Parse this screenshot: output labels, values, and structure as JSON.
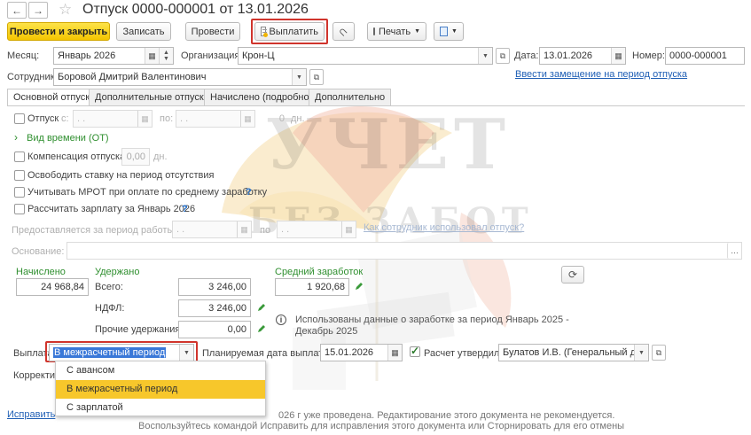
{
  "window": {
    "title": "Отпуск 0000-000001 от 13.01.2026"
  },
  "toolbar": {
    "post_and_close": "Провести и закрыть",
    "record": "Записать",
    "post": "Провести",
    "pay": "Выплатить",
    "print": "Печать"
  },
  "header": {
    "month_label": "Месяц:",
    "month_value": "Январь 2026",
    "org_label": "Организация:",
    "org_value": "Крон-Ц",
    "date_label": "Дата:",
    "date_value": "13.01.2026",
    "number_label": "Номер:",
    "number_value": "0000-000001",
    "employee_label": "Сотрудник:",
    "employee_value": "Боровой Дмитрий Валентинович",
    "replace_link": "Ввести замещение на период отпуска"
  },
  "tabs": [
    "Основной отпуск",
    "Дополнительные отпуска",
    "Начислено (подробно)",
    "Дополнительно"
  ],
  "main_tab": {
    "leave_label": "Отпуск",
    "from_label": "с:",
    "from_value": ". .",
    "to_label": "по:",
    "to_value": ". .",
    "days_value": "0",
    "days_unit": "дн.",
    "time_type_link": "Вид времени (ОТ)",
    "compensation_label": "Компенсация отпуска",
    "compensation_value": "0,00",
    "compensation_unit": "дн.",
    "free_rate_label": "Освободить ставку на период отсутствия",
    "mrot_label": "Учитывать МРОТ при оплате по среднему заработку",
    "help_mark": "?",
    "calc_salary_label": "Рассчитать зарплату за Январь 2026",
    "work_period_label": "Предоставляется за период работы с:",
    "work_period_from": ". .",
    "work_period_to_label": "по",
    "work_period_to": ". .",
    "how_used_link": "Как сотрудник использовал отпуск?",
    "basis_label": "Основание:",
    "accrued_label": "Начислено",
    "accrued_value": "24 968,84",
    "withheld_label": "Удержано",
    "total_label": "Всего:",
    "total_value": "3 246,00",
    "ndfl_label": "НДФЛ:",
    "ndfl_value": "3 246,00",
    "other_label": "Прочие удержания:",
    "other_value": "0,00",
    "avg_label": "Средний заработок",
    "avg_value": "1 920,68",
    "info_text_1": "Использованы данные о заработке за период Январь 2025 -",
    "info_text_2": "Декабрь 2025",
    "payout_label": "Выплата:",
    "payout_value": "В межрасчетный период",
    "planned_date_label": "Планируемая дата выплаты:",
    "planned_date_value": "15.01.2026",
    "calc_approved_label": "Расчет утвердил",
    "approver_value": "Булатов И.В. (Генеральный дире",
    "corrector_label": "Корректир"
  },
  "dropdown": {
    "options": [
      "С авансом",
      "В межрасчетный период",
      "С зарплатой"
    ],
    "selected_index": 1
  },
  "footer": {
    "fix_link": "Исправить",
    "notice_1": "026 г уже проведена. Редактирование этого документа не рекомендуется.",
    "notice_2": "Воспользуйтесь командой Исправить для исправления этого документа или Сторнировать для его отмены"
  },
  "watermark": {
    "line1": "УЧЕТ",
    "line2": "БЕЗ ЗАБОТ"
  },
  "colors": {
    "accent_yellow": "#f4c500",
    "highlight_red": "#d0342c",
    "link_blue": "#1f5fb5",
    "green": "#2f8f2f",
    "selected_option": "#f7c72b"
  }
}
